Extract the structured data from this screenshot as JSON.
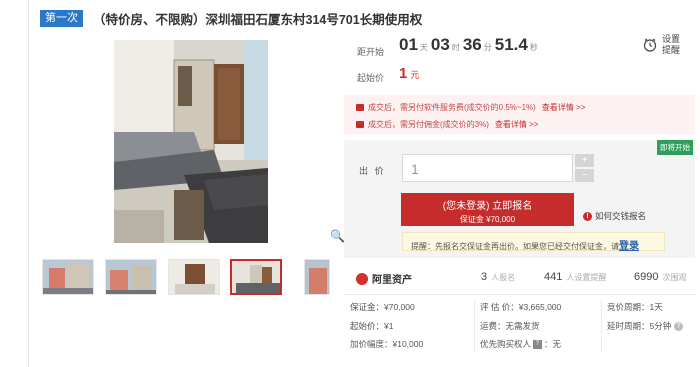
{
  "header": {
    "round_badge": "第一次",
    "title": "（特价房、不限购）深圳福田石厦东村314号701长期使用权"
  },
  "timing": {
    "countdown_label": "距开始",
    "countdown": [
      {
        "value": "01",
        "unit": "天"
      },
      {
        "value": "03",
        "unit": "时"
      },
      {
        "value": "36",
        "unit": "分"
      },
      {
        "value": "51.4",
        "unit": "秒"
      }
    ],
    "start_price_label": "起始价",
    "start_price": "1",
    "start_price_unit": "元"
  },
  "remind": {
    "line1": "设置",
    "line2": "提醒",
    "icon": "alarm-clock-icon"
  },
  "notices": [
    {
      "text": "成交后，需另付软件服务费(成交价的0.5%~1%)",
      "link": "查看详情 >>"
    },
    {
      "text": "成交后，需另付佣金(成交价的3%)",
      "link": "查看详情 >>"
    }
  ],
  "bid": {
    "live_badge": "即将开始",
    "label": "出 价",
    "input_value": "1",
    "signup_main": "(您未登录) 立即报名",
    "signup_sub": "保证金 ¥70,000",
    "howto": "如何交钱报名",
    "tip_text": "提醒：先报名交保证金再出价。如果您已经交付保证金，请",
    "tip_link": "登录"
  },
  "stats": {
    "brand": "阿里资产",
    "signups_num": "3",
    "signups_label": "人报名",
    "reminders_num": "441",
    "reminders_label": "人设置提醒",
    "views_num": "6990",
    "views_label": "次围观"
  },
  "info": {
    "deposit": "保证金：¥70,000",
    "start": "起始价：¥1",
    "increment": "加价幅度：¥10,000",
    "appraisal": "评 估 价：¥3,665,000",
    "shipping": "运费：无需发货",
    "priority_before": "优先购买权人",
    "priority_after": "：无",
    "cycle": "竞价周期：1天",
    "delay": "延时周期：5分钟"
  },
  "colors": {
    "accent": "#c62c2c",
    "round_badge": "#2b78c6",
    "live_badge": "#2f9e5a",
    "notice_bg": "#fdf1f1",
    "panel_bg": "#f4f4f4"
  }
}
